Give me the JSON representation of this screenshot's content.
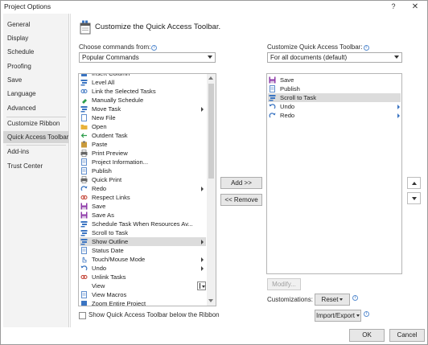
{
  "window": {
    "title": "Project Options",
    "help_label": "?",
    "close_label": "✕"
  },
  "sidebar": {
    "items": [
      {
        "label": "General"
      },
      {
        "label": "Display"
      },
      {
        "label": "Schedule"
      },
      {
        "label": "Proofing"
      },
      {
        "label": "Save"
      },
      {
        "label": "Language"
      },
      {
        "label": "Advanced"
      },
      {
        "label": "Customize Ribbon"
      },
      {
        "label": "Quick Access Toolbar",
        "selected": true
      },
      {
        "label": "Add-ins"
      },
      {
        "label": "Trust Center"
      }
    ]
  },
  "header": {
    "title": "Customize the Quick Access Toolbar.",
    "icon": "quick-access-toolbar-icon"
  },
  "choose_commands": {
    "label": "Choose commands from:",
    "value": "Popular Commands",
    "items": [
      {
        "label": "Insert Column",
        "icon": "insert-column-icon"
      },
      {
        "label": "Level All",
        "icon": "level-all-icon"
      },
      {
        "label": "Link the Selected Tasks",
        "icon": "link-tasks-icon"
      },
      {
        "label": "Manually Schedule",
        "icon": "manually-schedule-icon"
      },
      {
        "label": "Move Task",
        "icon": "move-task-icon",
        "submenu": true
      },
      {
        "label": "New File",
        "icon": "new-file-icon"
      },
      {
        "label": "Open",
        "icon": "open-folder-icon"
      },
      {
        "label": "Outdent Task",
        "icon": "outdent-icon"
      },
      {
        "label": "Paste",
        "icon": "paste-icon"
      },
      {
        "label": "Print Preview",
        "icon": "print-preview-icon"
      },
      {
        "label": "Project Information...",
        "icon": "project-info-icon"
      },
      {
        "label": "Publish",
        "icon": "publish-icon"
      },
      {
        "label": "Quick Print",
        "icon": "quick-print-icon"
      },
      {
        "label": "Redo",
        "icon": "redo-icon",
        "submenu": true
      },
      {
        "label": "Respect Links",
        "icon": "respect-links-icon"
      },
      {
        "label": "Save",
        "icon": "save-icon"
      },
      {
        "label": "Save As",
        "icon": "save-as-icon"
      },
      {
        "label": "Schedule Task When Resources Av...",
        "icon": "schedule-task-icon"
      },
      {
        "label": "Scroll to Task",
        "icon": "scroll-to-task-icon"
      },
      {
        "label": "Show Outline",
        "icon": "show-outline-icon",
        "submenu": true,
        "selected": true
      },
      {
        "label": "Status Date",
        "icon": "status-date-icon"
      },
      {
        "label": "Touch/Mouse Mode",
        "icon": "touch-mouse-icon",
        "submenu": true
      },
      {
        "label": "Undo",
        "icon": "undo-icon",
        "submenu": true
      },
      {
        "label": "Unlink Tasks",
        "icon": "unlink-tasks-icon"
      },
      {
        "label": "View",
        "icon": "view-icon",
        "split": true
      },
      {
        "label": "View Macros",
        "icon": "view-macros-icon"
      },
      {
        "label": "Zoom Entire Project",
        "icon": "zoom-icon"
      }
    ]
  },
  "customize_toolbar": {
    "label": "Customize Quick Access Toolbar:",
    "value": "For all documents (default)",
    "items": [
      {
        "label": "Save",
        "icon": "save-icon"
      },
      {
        "label": "Publish",
        "icon": "publish-icon"
      },
      {
        "label": "Scroll to Task",
        "icon": "scroll-to-task-icon",
        "selected": true
      },
      {
        "label": "Undo",
        "icon": "undo-icon",
        "submenu": true
      },
      {
        "label": "Redo",
        "icon": "redo-icon",
        "submenu": true
      }
    ]
  },
  "buttons": {
    "add": "Add >>",
    "remove": "<< Remove",
    "modify": "Modify...",
    "reset": "Reset",
    "import_export": "Import/Export",
    "ok": "OK",
    "cancel": "Cancel"
  },
  "checkbox": {
    "label": "Show Quick Access Toolbar below the Ribbon",
    "checked": false
  },
  "customizations_label": "Customizations:",
  "info_glyph": "i",
  "colors": {
    "selected_row": "#dcdcdc",
    "sidebar_bg": "#f3f3f3",
    "accent_blue": "#3a74c2"
  }
}
